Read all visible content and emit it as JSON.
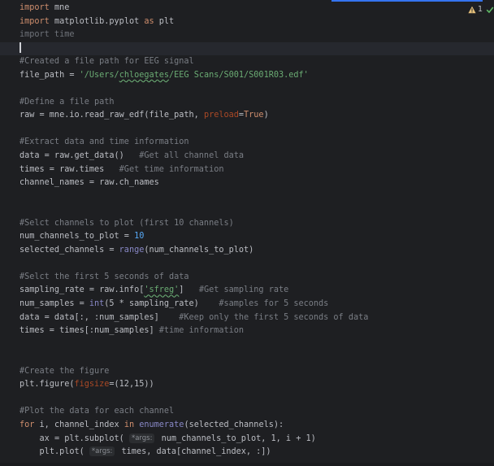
{
  "editor": {
    "inspection": {
      "warning_count": "1",
      "warning_icon": "warning-triangle-icon",
      "check_icon": "checkmark-icon",
      "colors": {
        "warning": "#e5c07b",
        "check": "#5fb865"
      }
    },
    "hints": {
      "args": "args"
    },
    "colors": {
      "background": "#1e1f22",
      "keyword": "#cf8e6d",
      "comment": "#7a7e85",
      "string": "#6aab73",
      "function": "#56a8f5",
      "parameter": "#aa4926",
      "builtin": "#8888c6",
      "accent": "#3574f0"
    },
    "lines": {
      "l1": {
        "kw": "import",
        "rest": " mne"
      },
      "l2": {
        "kw": "import",
        "mid": " matplotlib.pyplot ",
        "kw2": "as",
        "rest": " plt"
      },
      "l3": {
        "text": "import time"
      },
      "l5": {
        "comment": "#Created a file path for EEG signal"
      },
      "l6": {
        "pre": "file_path = ",
        "str_a": "'/Users/",
        "str_user": "chloegates",
        "str_b": "/EEG Scans/S001/S001R03.edf'"
      },
      "l8": {
        "comment": "#Define a file path"
      },
      "l9": {
        "pre": "raw = mne.io.read_raw_edf(file_path, ",
        "param": "preload",
        "eq": "=",
        "val": "True",
        "post": ")"
      },
      "l11": {
        "comment": "#Extract data and time information"
      },
      "l12": {
        "pre": "data = raw.get_data()   ",
        "comment": "#Get all channel data"
      },
      "l13": {
        "pre": "times = raw.times   ",
        "comment": "#Get time information"
      },
      "l14": {
        "text": "channel_names = raw.ch_names"
      },
      "l17": {
        "comment": "#Selct channels to plot (first 10 channels)"
      },
      "l18": {
        "pre": "num_channels_to_plot = ",
        "num": "10"
      },
      "l19": {
        "pre": "selected_channels = ",
        "fn": "range",
        "post": "(num_channels_to_plot)"
      },
      "l21": {
        "comment": "#Selct the first 5 seconds of data"
      },
      "l22": {
        "pre": "sampling_rate = raw.info[",
        "str": "'sfreg'",
        "post": "]   ",
        "comment": "#Get sampling rate"
      },
      "l23": {
        "pre": "num_samples = ",
        "fn": "int",
        "post": "(5 * sampling_rate)    ",
        "comment": "#samples for 5 seconds"
      },
      "l24": {
        "pre": "data = data[:, :num_samples]    ",
        "comment": "#Keep only the first 5 seconds of data"
      },
      "l25": {
        "pre": "times = times[:num_samples] ",
        "comment": "#time information"
      },
      "l28": {
        "comment": "#Create the figure"
      },
      "l29": {
        "pre": "plt.figure(",
        "param": "figsize",
        "post": "=(12,15))"
      },
      "l31": {
        "comment": "#Plot the data for each channel"
      },
      "l32": {
        "kw": "for",
        "mid": " i, channel_index ",
        "kw2": "in",
        "sp": " ",
        "fn": "enumerate",
        "post": "(selected_channels):"
      },
      "l33": {
        "indent": "    ",
        "pre": "ax = plt.subplot( ",
        "post": " num_channels_to_plot, 1, i + 1)"
      },
      "l34": {
        "indent": "    ",
        "pre": "plt.plot( ",
        "post": " times, data[channel_index, :])"
      }
    }
  }
}
